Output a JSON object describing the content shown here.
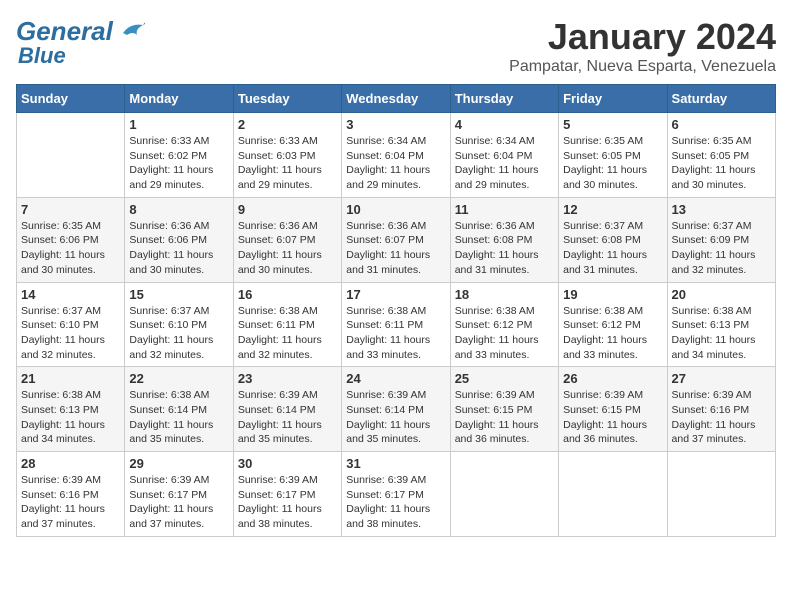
{
  "logo": {
    "top": "General",
    "bottom": "Blue"
  },
  "title": "January 2024",
  "subtitle": "Pampatar, Nueva Esparta, Venezuela",
  "weekdays": [
    "Sunday",
    "Monday",
    "Tuesday",
    "Wednesday",
    "Thursday",
    "Friday",
    "Saturday"
  ],
  "weeks": [
    [
      {
        "day": "",
        "sunrise": "",
        "sunset": "",
        "daylight": ""
      },
      {
        "day": "1",
        "sunrise": "Sunrise: 6:33 AM",
        "sunset": "Sunset: 6:02 PM",
        "daylight": "Daylight: 11 hours and 29 minutes."
      },
      {
        "day": "2",
        "sunrise": "Sunrise: 6:33 AM",
        "sunset": "Sunset: 6:03 PM",
        "daylight": "Daylight: 11 hours and 29 minutes."
      },
      {
        "day": "3",
        "sunrise": "Sunrise: 6:34 AM",
        "sunset": "Sunset: 6:04 PM",
        "daylight": "Daylight: 11 hours and 29 minutes."
      },
      {
        "day": "4",
        "sunrise": "Sunrise: 6:34 AM",
        "sunset": "Sunset: 6:04 PM",
        "daylight": "Daylight: 11 hours and 29 minutes."
      },
      {
        "day": "5",
        "sunrise": "Sunrise: 6:35 AM",
        "sunset": "Sunset: 6:05 PM",
        "daylight": "Daylight: 11 hours and 30 minutes."
      },
      {
        "day": "6",
        "sunrise": "Sunrise: 6:35 AM",
        "sunset": "Sunset: 6:05 PM",
        "daylight": "Daylight: 11 hours and 30 minutes."
      }
    ],
    [
      {
        "day": "7",
        "sunrise": "Sunrise: 6:35 AM",
        "sunset": "Sunset: 6:06 PM",
        "daylight": "Daylight: 11 hours and 30 minutes."
      },
      {
        "day": "8",
        "sunrise": "Sunrise: 6:36 AM",
        "sunset": "Sunset: 6:06 PM",
        "daylight": "Daylight: 11 hours and 30 minutes."
      },
      {
        "day": "9",
        "sunrise": "Sunrise: 6:36 AM",
        "sunset": "Sunset: 6:07 PM",
        "daylight": "Daylight: 11 hours and 30 minutes."
      },
      {
        "day": "10",
        "sunrise": "Sunrise: 6:36 AM",
        "sunset": "Sunset: 6:07 PM",
        "daylight": "Daylight: 11 hours and 31 minutes."
      },
      {
        "day": "11",
        "sunrise": "Sunrise: 6:36 AM",
        "sunset": "Sunset: 6:08 PM",
        "daylight": "Daylight: 11 hours and 31 minutes."
      },
      {
        "day": "12",
        "sunrise": "Sunrise: 6:37 AM",
        "sunset": "Sunset: 6:08 PM",
        "daylight": "Daylight: 11 hours and 31 minutes."
      },
      {
        "day": "13",
        "sunrise": "Sunrise: 6:37 AM",
        "sunset": "Sunset: 6:09 PM",
        "daylight": "Daylight: 11 hours and 32 minutes."
      }
    ],
    [
      {
        "day": "14",
        "sunrise": "Sunrise: 6:37 AM",
        "sunset": "Sunset: 6:10 PM",
        "daylight": "Daylight: 11 hours and 32 minutes."
      },
      {
        "day": "15",
        "sunrise": "Sunrise: 6:37 AM",
        "sunset": "Sunset: 6:10 PM",
        "daylight": "Daylight: 11 hours and 32 minutes."
      },
      {
        "day": "16",
        "sunrise": "Sunrise: 6:38 AM",
        "sunset": "Sunset: 6:11 PM",
        "daylight": "Daylight: 11 hours and 32 minutes."
      },
      {
        "day": "17",
        "sunrise": "Sunrise: 6:38 AM",
        "sunset": "Sunset: 6:11 PM",
        "daylight": "Daylight: 11 hours and 33 minutes."
      },
      {
        "day": "18",
        "sunrise": "Sunrise: 6:38 AM",
        "sunset": "Sunset: 6:12 PM",
        "daylight": "Daylight: 11 hours and 33 minutes."
      },
      {
        "day": "19",
        "sunrise": "Sunrise: 6:38 AM",
        "sunset": "Sunset: 6:12 PM",
        "daylight": "Daylight: 11 hours and 33 minutes."
      },
      {
        "day": "20",
        "sunrise": "Sunrise: 6:38 AM",
        "sunset": "Sunset: 6:13 PM",
        "daylight": "Daylight: 11 hours and 34 minutes."
      }
    ],
    [
      {
        "day": "21",
        "sunrise": "Sunrise: 6:38 AM",
        "sunset": "Sunset: 6:13 PM",
        "daylight": "Daylight: 11 hours and 34 minutes."
      },
      {
        "day": "22",
        "sunrise": "Sunrise: 6:38 AM",
        "sunset": "Sunset: 6:14 PM",
        "daylight": "Daylight: 11 hours and 35 minutes."
      },
      {
        "day": "23",
        "sunrise": "Sunrise: 6:39 AM",
        "sunset": "Sunset: 6:14 PM",
        "daylight": "Daylight: 11 hours and 35 minutes."
      },
      {
        "day": "24",
        "sunrise": "Sunrise: 6:39 AM",
        "sunset": "Sunset: 6:14 PM",
        "daylight": "Daylight: 11 hours and 35 minutes."
      },
      {
        "day": "25",
        "sunrise": "Sunrise: 6:39 AM",
        "sunset": "Sunset: 6:15 PM",
        "daylight": "Daylight: 11 hours and 36 minutes."
      },
      {
        "day": "26",
        "sunrise": "Sunrise: 6:39 AM",
        "sunset": "Sunset: 6:15 PM",
        "daylight": "Daylight: 11 hours and 36 minutes."
      },
      {
        "day": "27",
        "sunrise": "Sunrise: 6:39 AM",
        "sunset": "Sunset: 6:16 PM",
        "daylight": "Daylight: 11 hours and 37 minutes."
      }
    ],
    [
      {
        "day": "28",
        "sunrise": "Sunrise: 6:39 AM",
        "sunset": "Sunset: 6:16 PM",
        "daylight": "Daylight: 11 hours and 37 minutes."
      },
      {
        "day": "29",
        "sunrise": "Sunrise: 6:39 AM",
        "sunset": "Sunset: 6:17 PM",
        "daylight": "Daylight: 11 hours and 37 minutes."
      },
      {
        "day": "30",
        "sunrise": "Sunrise: 6:39 AM",
        "sunset": "Sunset: 6:17 PM",
        "daylight": "Daylight: 11 hours and 38 minutes."
      },
      {
        "day": "31",
        "sunrise": "Sunrise: 6:39 AM",
        "sunset": "Sunset: 6:17 PM",
        "daylight": "Daylight: 11 hours and 38 minutes."
      },
      {
        "day": "",
        "sunrise": "",
        "sunset": "",
        "daylight": ""
      },
      {
        "day": "",
        "sunrise": "",
        "sunset": "",
        "daylight": ""
      },
      {
        "day": "",
        "sunrise": "",
        "sunset": "",
        "daylight": ""
      }
    ]
  ]
}
